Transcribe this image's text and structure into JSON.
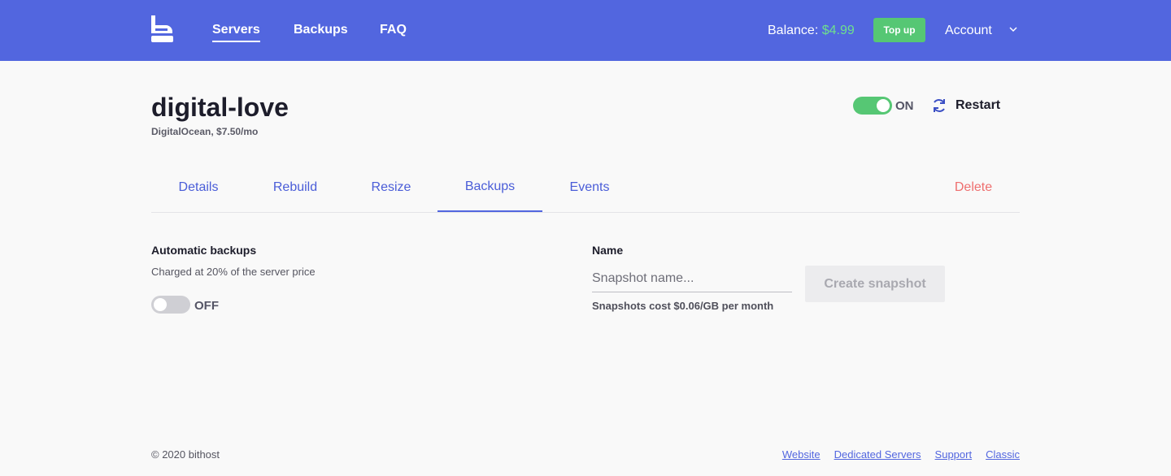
{
  "header": {
    "nav": [
      {
        "label": "Servers",
        "active": true
      },
      {
        "label": "Backups",
        "active": false
      },
      {
        "label": "FAQ",
        "active": false
      }
    ],
    "balance_label": "Balance:",
    "balance_amount": "$4.99",
    "topup_label": "Top up",
    "account_label": "Account",
    "brand_color": "#5266df",
    "accent_green": "#56c774"
  },
  "server": {
    "name": "digital-love",
    "subtitle": "DigitalOcean, $7.50/mo",
    "power_state": "ON",
    "restart_label": "Restart"
  },
  "tabs": [
    {
      "label": "Details"
    },
    {
      "label": "Rebuild"
    },
    {
      "label": "Resize"
    },
    {
      "label": "Backups",
      "active": true
    },
    {
      "label": "Events"
    }
  ],
  "delete_label": "Delete",
  "backups": {
    "title": "Automatic backups",
    "description": "Charged at 20% of the server price",
    "state": "OFF"
  },
  "snapshot": {
    "name_label": "Name",
    "placeholder": "Snapshot name...",
    "value": "",
    "cost_note": "Snapshots cost $0.06/GB per month",
    "button_label": "Create snapshot"
  },
  "footer": {
    "copyright": "© 2020 bithost",
    "links": [
      "Website",
      "Dedicated Servers",
      "Support",
      "Classic"
    ]
  },
  "icons": {
    "logo": "bithost-logo",
    "chevron": "chevron-down-icon",
    "restart": "refresh-icon"
  }
}
